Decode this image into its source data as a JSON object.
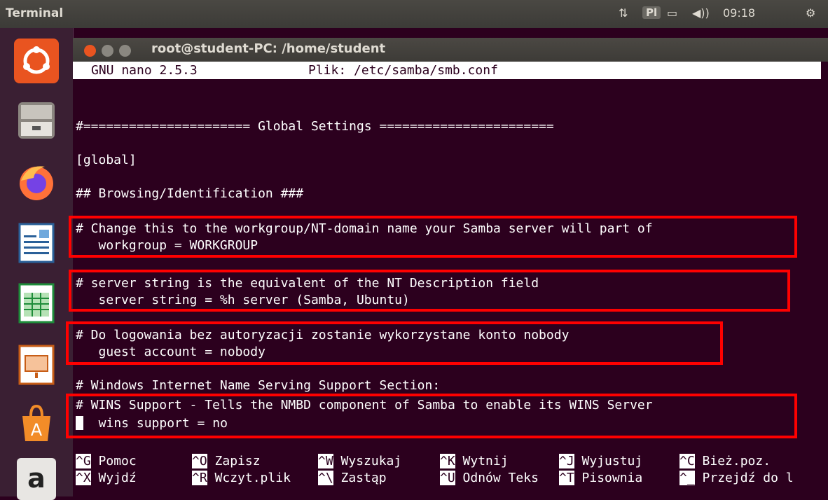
{
  "panel": {
    "app_title": "Terminal",
    "keyboard": "Pl",
    "clock": "09:18"
  },
  "window": {
    "title": "root@student-PC: /home/student"
  },
  "nano": {
    "version": "GNU nano 2.5.3",
    "file": "Plik: /etc/samba/smb.conf"
  },
  "editor": {
    "lines": [
      "#====================== Global Settings =======================",
      "[global]",
      "## Browsing/Identification ###",
      "# Change this to the workgroup/NT-domain name your Samba server will part of",
      "   workgroup = WORKGROUP",
      "# server string is the equivalent of the NT Description field",
      "   server string = %h server (Samba, Ubuntu)",
      "# Do logowania bez autoryzacji zostanie wykorzystane konto nobody",
      "   guest account = nobody",
      "# Windows Internet Name Serving Support Section:",
      "# WINS Support - Tells the NMBD component of Samba to enable its WINS Server",
      "  wins support = no"
    ]
  },
  "shortcuts": [
    {
      "key": "^G",
      "label": "Pomoc"
    },
    {
      "key": "^O",
      "label": "Zapisz"
    },
    {
      "key": "^W",
      "label": "Wyszukaj"
    },
    {
      "key": "^K",
      "label": "Wytnij"
    },
    {
      "key": "^J",
      "label": "Wyjustuj"
    },
    {
      "key": "^C",
      "label": "Bież.poz."
    },
    {
      "key": "^X",
      "label": "Wyjdź"
    },
    {
      "key": "^R",
      "label": "Wczyt.plik"
    },
    {
      "key": "^\\",
      "label": "Zastąp"
    },
    {
      "key": "^U",
      "label": "Odnów Teks"
    },
    {
      "key": "^T",
      "label": "Pisownia"
    },
    {
      "key": "^_",
      "label": "Przejdź do l"
    }
  ],
  "colors": {
    "terminal_bg": "#2c001e",
    "highlight": "#ff0000"
  },
  "launcher": [
    "ubuntu-dash-icon",
    "files-icon",
    "firefox-icon",
    "writer-icon",
    "calc-icon",
    "impress-icon",
    "software-center-icon",
    "amazon-icon"
  ]
}
